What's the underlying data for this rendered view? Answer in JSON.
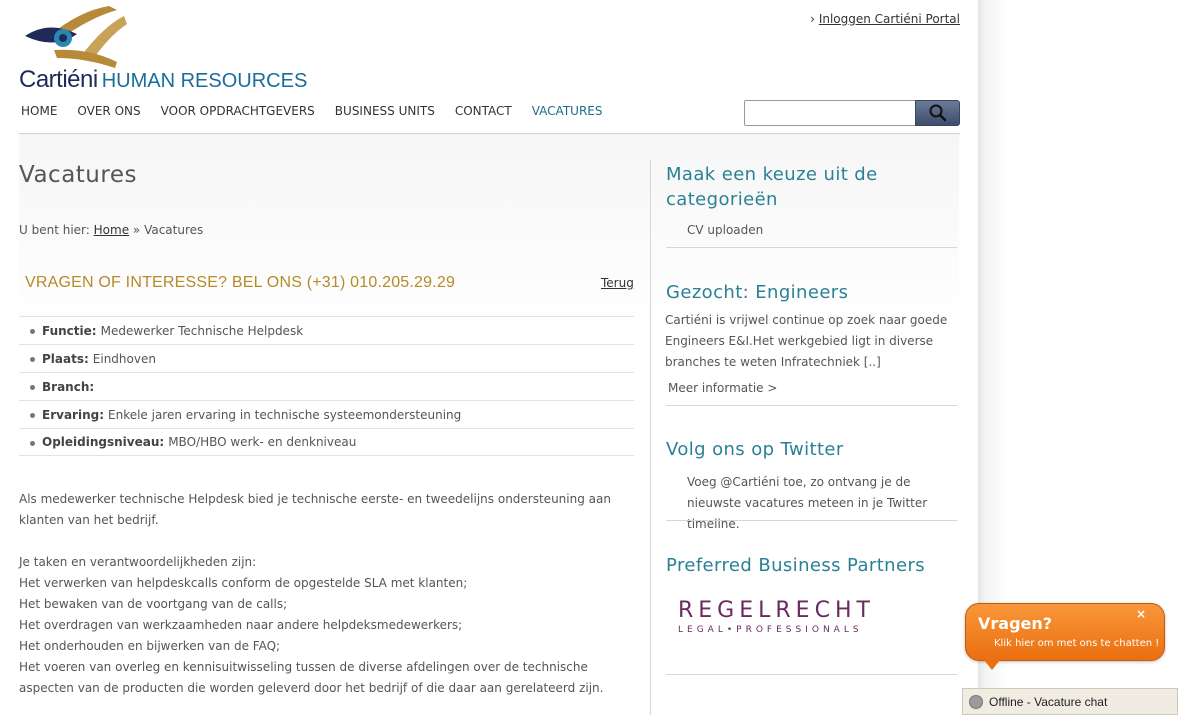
{
  "header": {
    "login_prefix": "›",
    "login_link": "Inloggen Cartiéni Portal",
    "logo_name": "Cartiéni",
    "logo_tagline": "HUMAN RESOURCES"
  },
  "nav": [
    {
      "label": "HOME"
    },
    {
      "label": "OVER ONS"
    },
    {
      "label": "VOOR OPDRACHTGEVERS"
    },
    {
      "label": "BUSINESS UNITS"
    },
    {
      "label": "CONTACT"
    },
    {
      "label": "VACATURES",
      "active": true
    }
  ],
  "search": {
    "value": "",
    "placeholder": ""
  },
  "main": {
    "title": "Vacatures",
    "breadcrumb_prefix": "U bent hier:",
    "breadcrumb_home": "Home",
    "breadcrumb_sep": "»",
    "breadcrumb_current": "Vacatures",
    "callout": "VRAGEN OF INTERESSE? BEL ONS (+31) 010.205.29.29",
    "back_link": "Terug",
    "facts": [
      {
        "label": "Functie:",
        "value": "Medewerker Technische Helpdesk"
      },
      {
        "label": "Plaats:",
        "value": "Eindhoven"
      },
      {
        "label": "Branch:",
        "value": ""
      },
      {
        "label": "Ervaring:",
        "value": "Enkele jaren ervaring in technische systeemondersteuning"
      },
      {
        "label": "Opleidingsniveau:",
        "value": "MBO/HBO werk- en denkniveau"
      }
    ],
    "intro": "Als medewerker technische Helpdesk bied je technische eerste- en tweedelijns ondersteuning aan klanten van het bedrijf.",
    "tasks_heading": "Je taken en verantwoordelijkheden zijn:",
    "tasks": [
      "Het verwerken van helpdeskcalls conform de opgestelde SLA met klanten;",
      "Het bewaken van de voortgang van de calls;",
      "Het overdragen van werkzaamheden naar andere helpdeksmedewerkers;",
      "Het onderhouden en bijwerken van de FAQ;",
      "Het voeren van overleg en kennisuitwisseling tussen de diverse afdelingen over de technische aspecten van de producten die worden geleverd door het bedrijf of die daar aan gerelateerd zijn."
    ]
  },
  "sidebar": {
    "categories_title": "Maak een keuze uit de categorieën",
    "categories_item": "CV uploaden",
    "engineers_title": "Gezocht: Engineers",
    "engineers_text": "Cartiéni is vrijwel continue op zoek naar goede Engineers E&I.Het werkgebied ligt in diverse branches te weten Infratechniek [..]",
    "engineers_more": "Meer informatie >",
    "twitter_title": "Volg ons op Twitter",
    "twitter_text": "Voeg @Cartiéni toe, zo ontvang je de nieuwste vacatures meteen in je Twitter timeline.",
    "partners_title": "Preferred Business Partners",
    "partner_logo_main": "REGELRECHT",
    "partner_logo_sub": "LEGAL•PROFESSIONALS"
  },
  "chat": {
    "title": "Vragen?",
    "subtitle": "Klik hier om met ons te chatten !",
    "close": "×",
    "status": "Offline - Vacature chat"
  },
  "colors": {
    "accent_teal": "#2a8196",
    "callout_gold": "#b58a2a",
    "chat_orange": "#ea6f10",
    "logo_navy": "#1e2a5a"
  }
}
